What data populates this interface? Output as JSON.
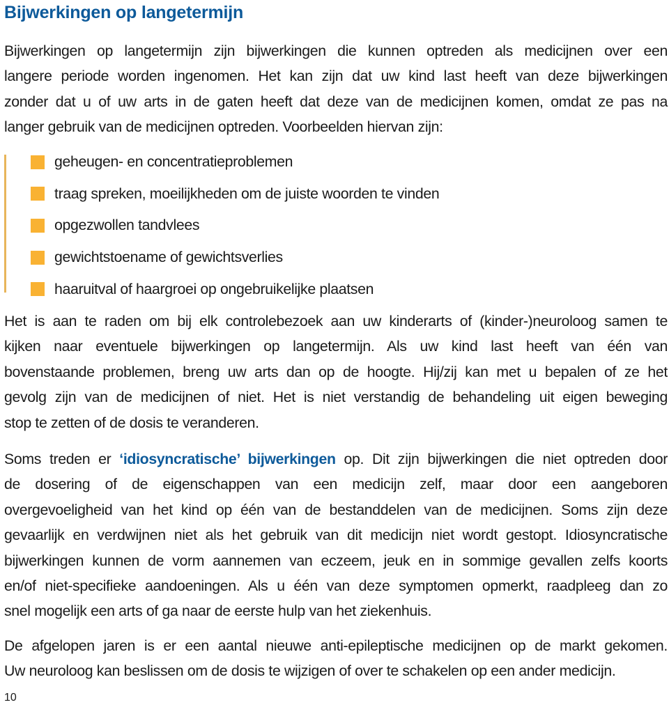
{
  "title": "Bijwerkingen op langetermijn",
  "intro_lines": [
    "Bijwerkingen op langetermijn zijn bijwerkingen die kunnen optreden als medicijnen over een",
    "langere periode worden ingenomen. Het kan zijn dat uw kind last heeft van deze bijwerkingen",
    "zonder dat u of uw arts in de gaten heeft dat deze van de medicijnen komen, omdat ze pas na",
    "langer gebruik van de medicijnen optreden. Voorbeelden hiervan zijn:"
  ],
  "list_items": [
    "geheugen- en concentratieproblemen",
    "traag spreken, moeilijkheden om de juiste woorden te vinden",
    "opgezwollen tandvlees",
    "gewichtstoename of gewichtsverlies",
    "haaruitval of haargroei op ongebruikelijke plaatsen"
  ],
  "para2_lines": [
    "Het is aan te raden om bij elk controlebezoek aan uw kinderarts of (kinder-)neuroloog samen te",
    "kijken naar eventuele bijwerkingen op langetermijn. Als uw kind last heeft van één van",
    "bovenstaande problemen, breng uw arts dan op de hoogte. Hij/zij kan met u bepalen of ze het",
    "gevolg zijn van de medicijnen of niet. Het is niet verstandig de behandeling uit eigen beweging",
    "stop te zetten of de dosis te veranderen."
  ],
  "para3": {
    "line1_prefix": "Soms treden er ",
    "line1_highlight": "‘idiosyncratische’ bijwerkingen",
    "line1_suffix": " op. Dit zijn bijwerkingen die niet optreden door",
    "lines": [
      "de dosering of de eigenschappen van een medicijn zelf, maar door een aangeboren",
      "overgevoeligheid van het kind op één van de bestanddelen van de medicijnen. Soms zijn deze",
      "gevaarlijk en verdwijnen niet als het gebruik van dit medicijn niet wordt gestopt. Idiosyncratische",
      "bijwerkingen kunnen de vorm aannemen van eczeem, jeuk en in sommige gevallen zelfs koorts",
      "en/of niet-specifieke aandoeningen. Als u één van deze symptomen opmerkt, raadpleeg dan zo",
      "snel mogelijk een arts of ga naar de eerste hulp van het ziekenhuis."
    ]
  },
  "para4_lines": [
    "De afgelopen jaren is er een aantal nieuwe anti-epileptische medicijnen op de markt gekomen.",
    "Uw neuroloog kan beslissen om de dosis te wijzigen of over te schakelen op een ander medicijn."
  ],
  "page_number": "10",
  "colors": {
    "heading": "#0d5a9a",
    "bullet": "#f9b233",
    "side_bar": "#e8b55a",
    "text": "#1a1a1a"
  }
}
